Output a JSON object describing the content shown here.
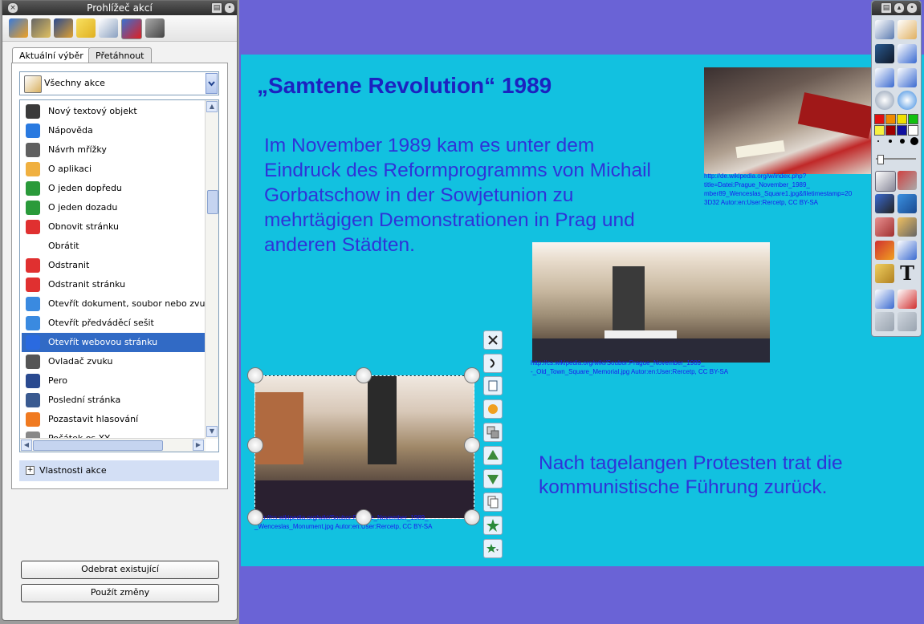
{
  "panel": {
    "title": "Prohlížeč akcí",
    "tabs": [
      "Aktuální výběr",
      "Přetáhnout"
    ],
    "filter_value": "Všechny akce",
    "list_items": [
      {
        "label": "Nový textový objekt",
        "icon": "text-add-icon"
      },
      {
        "label": "Nápověda",
        "icon": "help-icon"
      },
      {
        "label": "Návrh mřížky",
        "icon": "grid-icon"
      },
      {
        "label": "O aplikaci",
        "icon": "about-icon"
      },
      {
        "label": "O jeden dopředu",
        "icon": "bring-forward-icon"
      },
      {
        "label": "O jeden dozadu",
        "icon": "send-backward-icon"
      },
      {
        "label": "Obnovit stránku",
        "icon": "refresh-icon"
      },
      {
        "label": "Obrátit",
        "icon": "flip-icon"
      },
      {
        "label": "Odstranit",
        "icon": "delete-icon"
      },
      {
        "label": "Odstranit stránku",
        "icon": "delete-page-icon"
      },
      {
        "label": "Otevřít dokument, soubor nebo zvuk",
        "icon": "open-document-icon"
      },
      {
        "label": "Otevřít předváděcí sešit",
        "icon": "open-flipchart-icon"
      },
      {
        "label": "Otevřít webovou stránku",
        "icon": "globe-icon"
      },
      {
        "label": "Ovladač zvuku",
        "icon": "speaker-icon"
      },
      {
        "label": "Pero",
        "icon": "pen-icon"
      },
      {
        "label": "Poslední stránka",
        "icon": "last-page-icon"
      },
      {
        "label": "Pozastavit hlasování",
        "icon": "pause-icon"
      },
      {
        "label": "Počátek os XY",
        "icon": "axes-icon"
      }
    ],
    "selected_index": 12,
    "properties_label": "Vlastnosti akce",
    "buttons": {
      "remove": "Odebrat existující",
      "apply": "Použít změny"
    }
  },
  "slide": {
    "title": "„Samtene Revolution“ 1989",
    "paragraph1": "Im November 1989 kam es unter dem\nEindruck des Reformprogramms von Michail\nGorbatschow in der Sowjetunion zu\nmehrtägigen Demonstrationen in Prag und\nanderen Städten.",
    "paragraph2": "Nach tagelangen Protesten trat die\nkommunistische Führung zurück.",
    "caption_top": "http://de.wikipedia.org/w/index.php?title=Datei:Prague_November_1989_\nmber89_Wenceslas_Square1.jpg&filetimestamp=20\n3D32  Autor:en:User:Rercetp, CC BY-SA",
    "caption_mid": "http://cs.wikipedia.org/wiki/Soubor:Prague_November_1989_\n-_Old_Town_Square_Memorial.jpg   Autor:en:User:Rercetp, CC BY-SA",
    "caption_low": "http://cs.wikipedia.org/wiki/Soubor:Prague_November_1989_\n_Wenceslas_Monument.jpg   Autor:en:User:Rercetp, CC BY-SA"
  },
  "colors": {
    "background": "#6a63d6",
    "slide": "#12c1e0",
    "title": "#1c22c0",
    "text": "#2f33d8",
    "selection": "#316ac5"
  },
  "palette": [
    "#e01010",
    "#f08a00",
    "#f0e000",
    "#10c010",
    "#f6f040",
    "#a00000",
    "#1010a0",
    "#ffffff"
  ]
}
